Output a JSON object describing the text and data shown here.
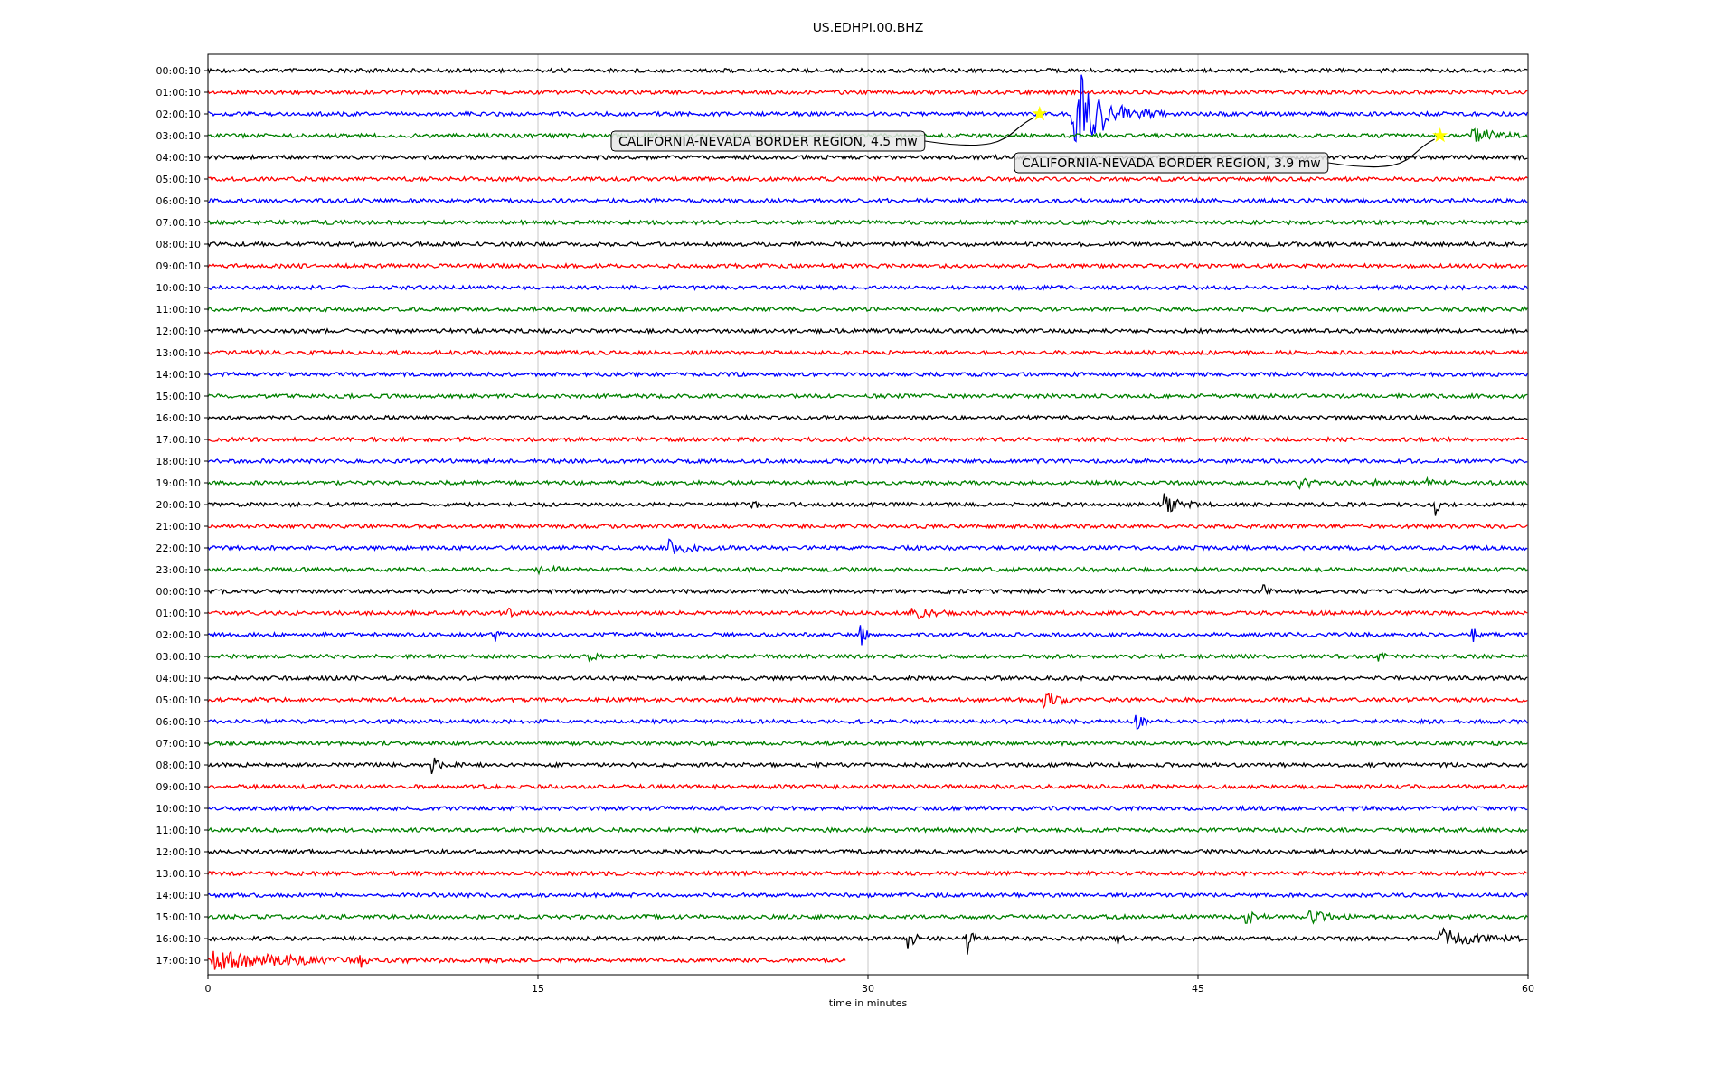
{
  "title": "US.EDHPI.00.BHZ",
  "plot": {
    "xlabel": "time in minutes",
    "xticks": [
      "0",
      "15",
      "30",
      "45",
      "60"
    ],
    "rows": [
      {
        "label": "00:00:10",
        "color": "#000000"
      },
      {
        "label": "01:00:10",
        "color": "#ff0000"
      },
      {
        "label": "02:00:10",
        "color": "#0000ff"
      },
      {
        "label": "03:00:10",
        "color": "#008000"
      },
      {
        "label": "04:00:10",
        "color": "#000000"
      },
      {
        "label": "05:00:10",
        "color": "#ff0000"
      },
      {
        "label": "06:00:10",
        "color": "#0000ff"
      },
      {
        "label": "07:00:10",
        "color": "#008000"
      },
      {
        "label": "08:00:10",
        "color": "#000000"
      },
      {
        "label": "09:00:10",
        "color": "#ff0000"
      },
      {
        "label": "10:00:10",
        "color": "#0000ff"
      },
      {
        "label": "11:00:10",
        "color": "#008000"
      },
      {
        "label": "12:00:10",
        "color": "#000000"
      },
      {
        "label": "13:00:10",
        "color": "#ff0000"
      },
      {
        "label": "14:00:10",
        "color": "#0000ff"
      },
      {
        "label": "15:00:10",
        "color": "#008000"
      },
      {
        "label": "16:00:10",
        "color": "#000000"
      },
      {
        "label": "17:00:10",
        "color": "#ff0000"
      },
      {
        "label": "18:00:10",
        "color": "#0000ff"
      },
      {
        "label": "19:00:10",
        "color": "#008000"
      },
      {
        "label": "20:00:10",
        "color": "#000000"
      },
      {
        "label": "21:00:10",
        "color": "#ff0000"
      },
      {
        "label": "22:00:10",
        "color": "#0000ff"
      },
      {
        "label": "23:00:10",
        "color": "#008000"
      },
      {
        "label": "00:00:10",
        "color": "#000000"
      },
      {
        "label": "01:00:10",
        "color": "#ff0000"
      },
      {
        "label": "02:00:10",
        "color": "#0000ff"
      },
      {
        "label": "03:00:10",
        "color": "#008000"
      },
      {
        "label": "04:00:10",
        "color": "#000000"
      },
      {
        "label": "05:00:10",
        "color": "#ff0000"
      },
      {
        "label": "06:00:10",
        "color": "#0000ff"
      },
      {
        "label": "07:00:10",
        "color": "#008000"
      },
      {
        "label": "08:00:10",
        "color": "#000000"
      },
      {
        "label": "09:00:10",
        "color": "#ff0000"
      },
      {
        "label": "10:00:10",
        "color": "#0000ff"
      },
      {
        "label": "11:00:10",
        "color": "#008000"
      },
      {
        "label": "12:00:10",
        "color": "#000000"
      },
      {
        "label": "13:00:10",
        "color": "#ff0000"
      },
      {
        "label": "14:00:10",
        "color": "#0000ff"
      },
      {
        "label": "15:00:10",
        "color": "#008000"
      },
      {
        "label": "16:00:10",
        "color": "#000000"
      },
      {
        "label": "17:00:10",
        "color": "#ff0000"
      }
    ],
    "annotations": [
      {
        "text": "CALIFORNIA-NEVADA BORDER REGION, 4.5 mw"
      },
      {
        "text": "CALIFORNIA-NEVADA BORDER REGION, 3.9 mw"
      }
    ]
  }
}
